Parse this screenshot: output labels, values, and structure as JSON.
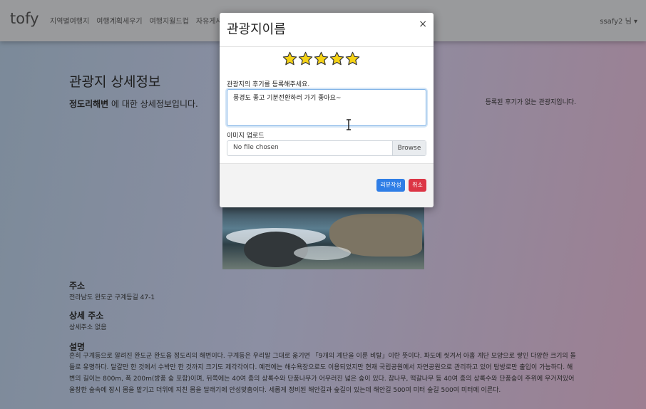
{
  "navbar": {
    "brand": "tofy",
    "links": [
      "지역별여행지",
      "여행계획세우기",
      "여행지월드컵",
      "자유게시판"
    ],
    "user": "ssafy2 님 ▾"
  },
  "page": {
    "title": "관광지 상세정보",
    "place_name": "정도리해변",
    "subtitle_suffix": " 에 대한 상세정보입니다.",
    "no_review_text": "등록된 후기가 없는 관광지입니다.",
    "address_title": "주소",
    "address_value": "전라남도 완도군 구계등길 47-1",
    "detail_address_title": "상세 주소",
    "detail_address_value": "상세주소 없음",
    "description_title": "설명",
    "description": "흔히 구계등으로 알려진 완도군 완도읍 정도리의 해변이다. 구계등은 우리말 그대로 옮기면 「9개의 계단을 이룬 비탈」이란 뜻이다. 파도에 씻겨서 아홉 계단 모양으로 쌓인 다양한 크기의 돌들로 유명하다. 달걀만 한 것에서 수박만 한 것까지 크기도 제각각이다. 예전에는 해수욕장으로도 이용되었지만 현재 국립공원에서 자연공원으로 관리하고 있어 탐방로만 출입이 가능하다. 해변의 길이는 800m, 폭 200m(방풍 숲 포함)이며, 뒤쪽에는 40여 종의 상록수와 단풍나무가 어우러진 넓은 숲이 있다. 참나무, 떡갈나무 등 40여 종의 상록수와 단풍숲이 주위에 우거져있어 울창한 숲속에 잠시 몸을 맡기고 더위에 지친 몸을 달래기에 안성맞춤이다. 세롭게 정비된 해안길과 숲길이 있는데 해안길 500여 미터 숲길 500여 미터에 이른다."
  },
  "modal": {
    "title": "관광지이름",
    "close_label": "×",
    "rating": 5,
    "rating_max": 5,
    "review_label": "관광지의 후기를 등록해주세요.",
    "review_value": "풍경도 좋고 기분전환하러 가기 좋아요~",
    "upload_label": "이미지 업로드",
    "file_placeholder": "No file chosen",
    "browse_label": "Browse",
    "submit_label": "리뷰작성",
    "cancel_label": "취소"
  },
  "colors": {
    "primary": "#2f7ee6",
    "danger": "#dc3545",
    "star": "#f5d215"
  }
}
